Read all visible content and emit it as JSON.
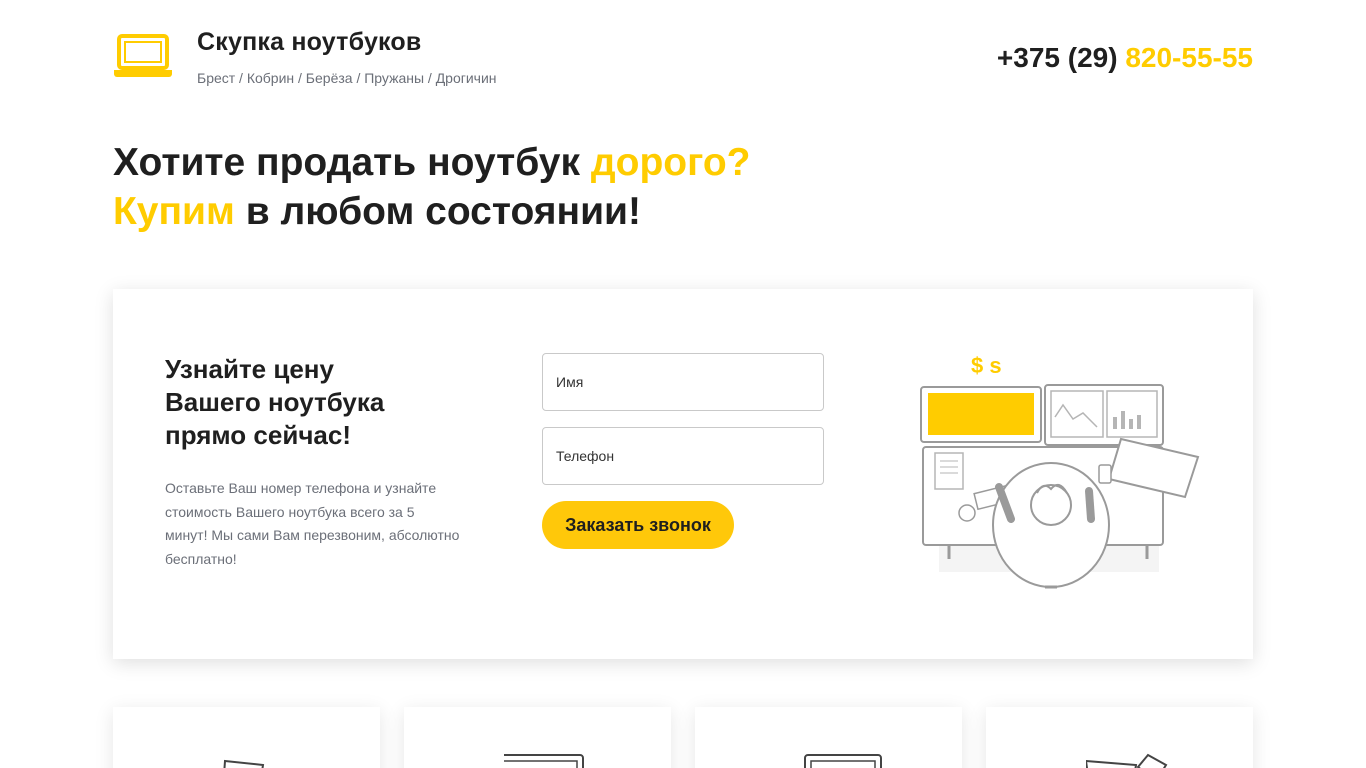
{
  "header": {
    "brand_title": "Скупка ноутбуков",
    "cities": "Брест / Кобрин / Берёза / Пружаны / Дрогичин",
    "phone_prefix": "+375 (29) ",
    "phone_number": "820-55-55"
  },
  "hero": {
    "line1_a": "Хотите продать ноутбук ",
    "line1_b": "дорого?",
    "line2_a": "Купим",
    "line2_b": " в любом состоянии!"
  },
  "form_card": {
    "title_l1": "Узнайте цену",
    "title_l2": "Вашего ноутбука",
    "title_l3": "прямо сейчас!",
    "description": "Оставьте Ваш номер телефона и узнайте стоимость Вашего ноутбука всего за 5 минут! Мы сами Вам перезвоним, абсолютно бесплатно!",
    "name_placeholder": "Имя",
    "phone_placeholder": "Телефон",
    "cta_label": "Заказать звонок",
    "illustration_text": "$ s"
  },
  "icons": {
    "logo": "laptop-icon",
    "features": [
      "broken-laptop-icon",
      "laptop-icon",
      "laptop-icon",
      "broken-laptop-icon"
    ]
  },
  "colors": {
    "accent": "#ffcc00",
    "text": "#1f1f1f",
    "muted": "#6b6f78"
  }
}
